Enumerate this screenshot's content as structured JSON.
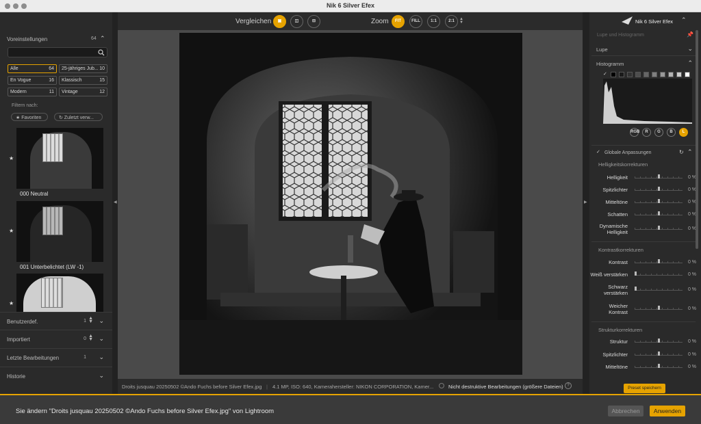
{
  "window": {
    "title": "Nik 6 Silver Efex"
  },
  "left_panel": {
    "presets_header": "Voreinstellungen",
    "presets_count": "64",
    "search": {
      "value": "",
      "placeholder": ""
    },
    "chips": [
      {
        "label": "Alle",
        "count": "64"
      },
      {
        "label": "25-jähriges Jub...",
        "count": "10"
      },
      {
        "label": "En Vogue",
        "count": "16"
      },
      {
        "label": "Klassisch",
        "count": "15"
      },
      {
        "label": "Modern",
        "count": "11"
      },
      {
        "label": "Vintage",
        "count": "12"
      }
    ],
    "filter_label": "Filtern nach:",
    "filter_favorites": "★ Favoriten",
    "filter_recent": "↻ Zuletzt verw...",
    "thumbnails": [
      {
        "label": "000 Neutral"
      },
      {
        "label": "001 Unterbelichtet (LW -1)"
      },
      {
        "label": ""
      }
    ],
    "rows": [
      {
        "label": "Benutzerdef.",
        "count": "1"
      },
      {
        "label": "Importiert",
        "count": "0"
      },
      {
        "label": "Letzte Bearbeitungen",
        "count": "1"
      },
      {
        "label": "Historie",
        "count": ""
      }
    ]
  },
  "toolbar": {
    "compare_label": "Vergleichen",
    "zoom_label": "Zoom",
    "zoom_buttons": [
      "FIT",
      "FILL",
      "1:1",
      "2:1"
    ]
  },
  "status": {
    "filename": "Droits jusquau 20250502 ©Ando Fuchs before Silver Efex.jpg",
    "info": "4.1 MP, ISO: 640, Kamerahersteller: NIKON CORPORATION, Kamer...",
    "nondestructive": "Nicht destruktive Bearbeitungen (größere Dateien)"
  },
  "right_panel": {
    "brand": "Nik 6 Silver Efex",
    "loupe_header": "Lupe und Histogramm",
    "lupe": "Lupe",
    "histogram": "Histogramm",
    "channels": [
      "RGB",
      "R",
      "G",
      "B",
      "L"
    ],
    "global_header": "Globale Anpassungen",
    "brightness_header": "Helligkeitskorrekturen",
    "brightness_sliders": [
      {
        "label": "Helligkeit",
        "value": "0 %"
      },
      {
        "label": "Spitzlichter",
        "value": "0 %"
      },
      {
        "label": "Mitteltöne",
        "value": "0 %"
      },
      {
        "label": "Schatten",
        "value": "0 %"
      },
      {
        "label": "Dynamische Helligkeit",
        "value": "0 %"
      }
    ],
    "contrast_header": "Kontrastkorrekturen",
    "contrast_sliders": [
      {
        "label": "Kontrast",
        "value": "0 %"
      },
      {
        "label": "Weiß verstärken",
        "value": "0 %"
      },
      {
        "label": "Schwarz verstärken",
        "value": "0 %"
      },
      {
        "label": "Weicher Kontrast",
        "value": "0 %"
      }
    ],
    "structure_header": "Strukturkorrekturen",
    "structure_sliders": [
      {
        "label": "Struktur",
        "value": "0 %"
      },
      {
        "label": "Spitzlichter",
        "value": "0 %"
      },
      {
        "label": "Mitteltöne",
        "value": "0 %"
      }
    ],
    "preset_save": "Preset speichern"
  },
  "bottom": {
    "message": "Sie ändern \"Droits jusquau 20250502 ©Ando Fuchs before Silver Efex.jpg\" von Lightroom",
    "cancel": "Abbrechen",
    "apply": "Anwenden"
  },
  "colors": {
    "accent": "#e6a300",
    "panel": "#2a2a2a",
    "canvas": "#4a4a4a"
  }
}
